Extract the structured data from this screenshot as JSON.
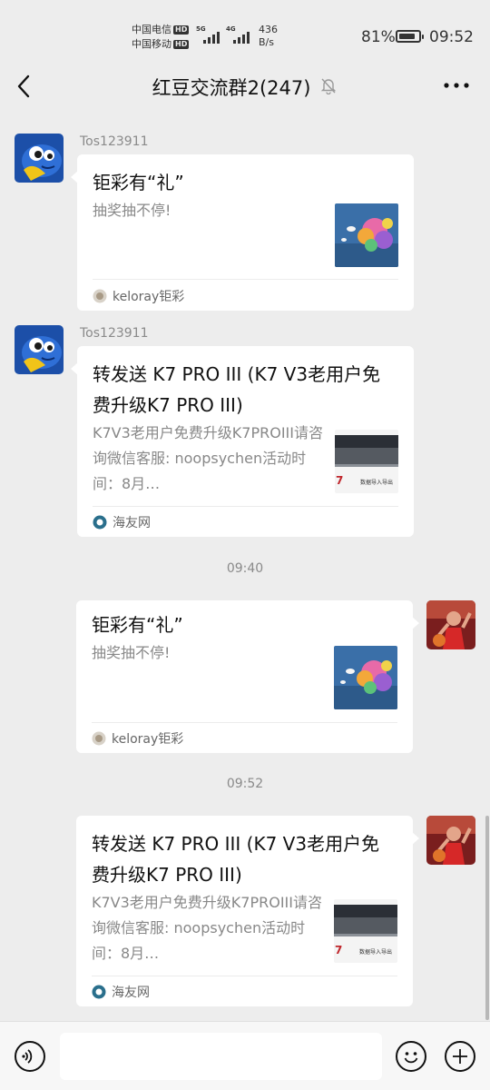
{
  "status": {
    "carrier1": "中国电信",
    "carrier2": "中国移动",
    "hd": "HD",
    "signal1": "5G",
    "signal2": "4G",
    "net_speed_value": "436",
    "net_speed_unit": "B/s",
    "battery_pct": "81%",
    "battery_level": 0.81,
    "time": "09:52"
  },
  "header": {
    "title": "红豆交流群2(247)",
    "back_icon": "chevron-left-icon",
    "mute_icon": "bell-off-icon",
    "more_icon": "more-dots-icon"
  },
  "messages": [
    {
      "side": "left",
      "sender": "Tos123911",
      "title": "钜彩有“礼”",
      "desc": "抽奖抽不停!",
      "source": "keloray钜彩"
    },
    {
      "side": "left",
      "sender": "Tos123911",
      "title": "转发送 K7 PRO III (K7 V3老用户免费升级K7 PRO III)",
      "desc": "K7V3老用户免费升级K7PROIII请咨询微信客服: noopsychen活动时间：8月…",
      "source": "海友网"
    },
    {
      "timestamp": "09:40"
    },
    {
      "side": "right",
      "title": "钜彩有“礼”",
      "desc": "抽奖抽不停!",
      "source": "keloray钜彩"
    },
    {
      "timestamp": "09:52"
    },
    {
      "side": "right",
      "title": "转发送 K7 PRO III (K7 V3老用户免费升级K7 PRO III)",
      "desc": "K7V3老用户免费升级K7PROIII请咨询微信客服: noopsychen活动时间：8月…",
      "source": "海友网"
    }
  ],
  "thumb_text": {
    "k7_label_a": "7",
    "k7_label_b": "数据导入导出"
  },
  "input_bar": {
    "voice_icon": "voice-icon",
    "emoji_icon": "emoji-icon",
    "plus_icon": "plus-icon",
    "placeholder": ""
  },
  "colors": {
    "background": "#ededed",
    "card": "#ffffff",
    "secondary_text": "#888888"
  }
}
